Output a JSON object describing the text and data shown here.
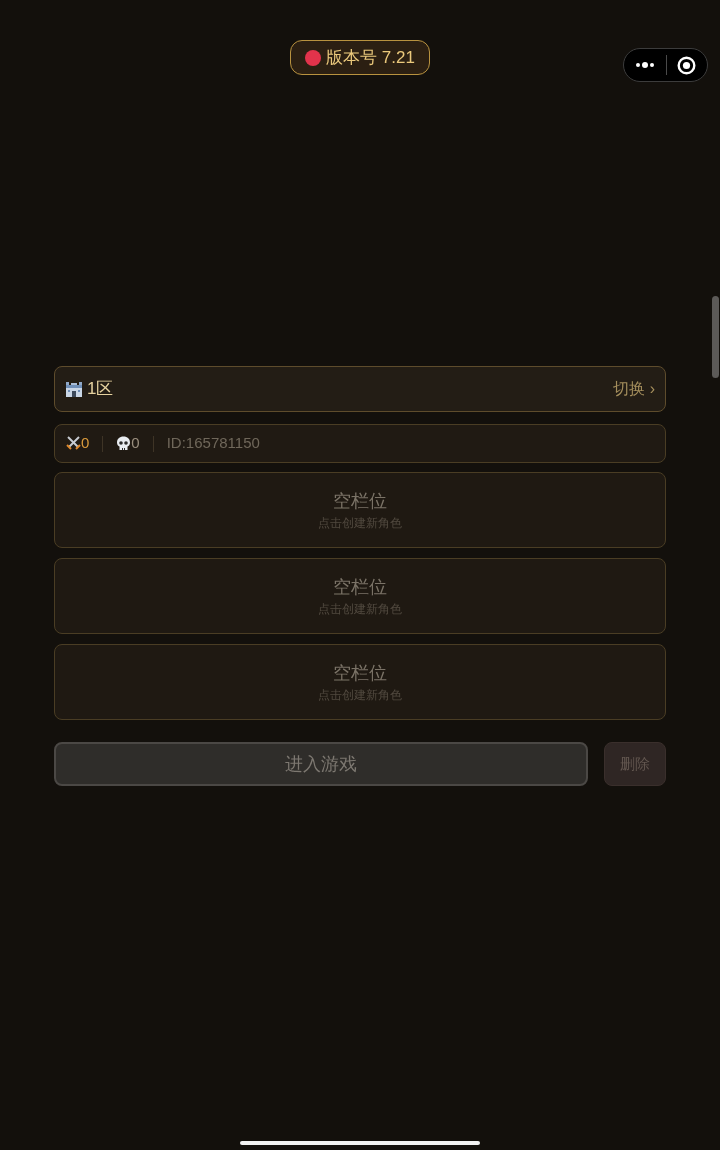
{
  "version_badge": {
    "label": "版本号 7.21"
  },
  "server": {
    "name": "1区",
    "switch_label": "切换 ›"
  },
  "stats": [
    {
      "kind": "sword",
      "value": "0"
    },
    {
      "kind": "skull",
      "value": "0"
    }
  ],
  "player_id": "ID:165781150",
  "slots": [
    {
      "title": "空栏位",
      "hint": "点击创建新角色"
    },
    {
      "title": "空栏位",
      "hint": "点击创建新角色"
    },
    {
      "title": "空栏位",
      "hint": "点击创建新角色"
    }
  ],
  "actions": [
    {
      "kind": "enter",
      "label": "进入游戏",
      "disabled": true
    },
    {
      "kind": "delete",
      "label": "删除",
      "disabled": true
    }
  ]
}
